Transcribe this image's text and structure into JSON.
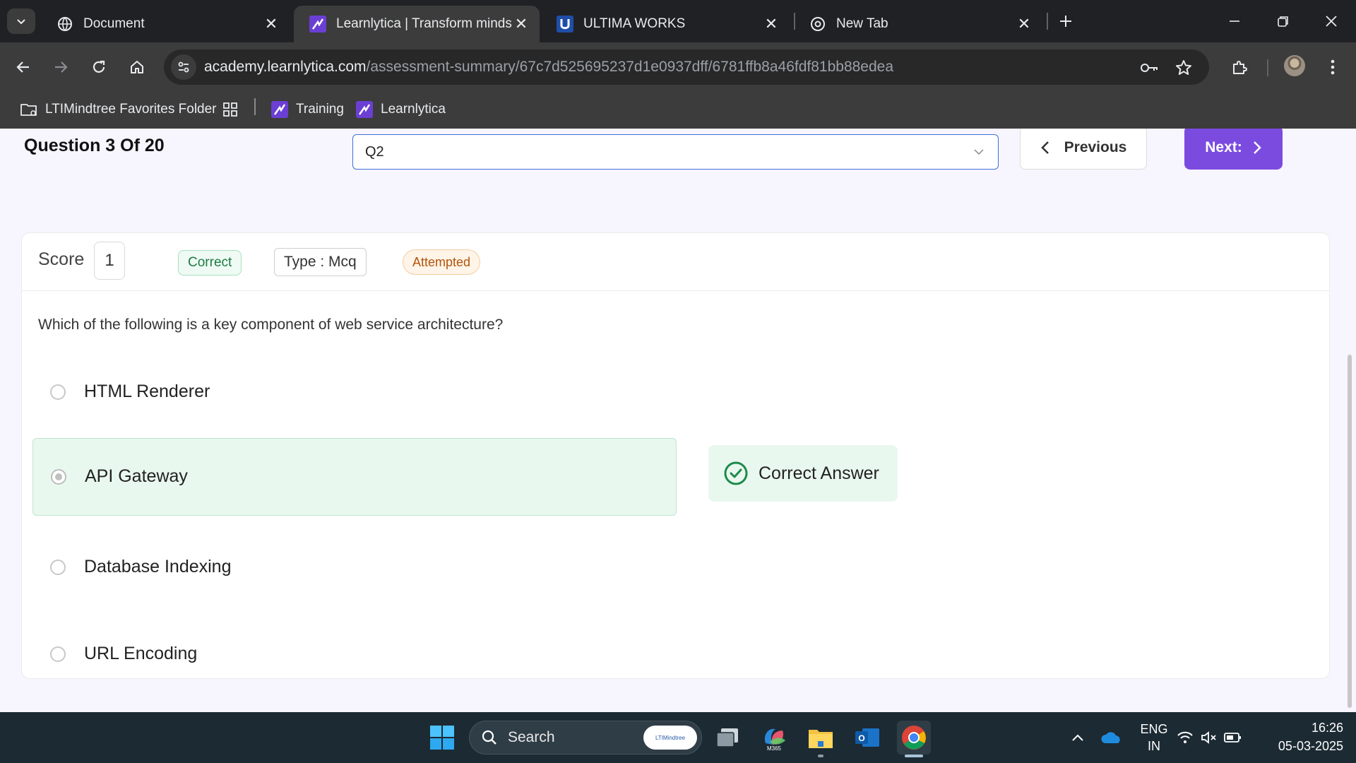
{
  "browser": {
    "tabs": [
      {
        "title": "Document",
        "favicon": "globe-icon",
        "active": false
      },
      {
        "title": "Learnlytica | Transform minds w",
        "favicon": "learnlytica-logo-icon",
        "active": true
      },
      {
        "title": "ULTIMA WORKS",
        "favicon": "ultima-logo-icon",
        "active": false
      },
      {
        "title": "New Tab",
        "favicon": "chrome-icon",
        "active": false
      }
    ],
    "url_host": "academy.learnlytica.com",
    "url_path": "/assessment-summary/67c7d525695237d1e0937dff/6781ffb8a46fdf81bb88edea",
    "bookmarks": [
      {
        "label": "LTIMindtree Favorites Folder",
        "icon": "folder-icon"
      },
      {
        "label": "",
        "icon": "apps-grid-icon"
      },
      {
        "label": "Training",
        "icon": "learnlytica-logo-icon"
      },
      {
        "label": "Learnlytica",
        "icon": "learnlytica-logo-icon"
      }
    ]
  },
  "assessment": {
    "counter": "Question 3 Of 20",
    "selected_question": "Q2",
    "prev_label": "Previous",
    "next_label": "Next:",
    "score_label": "Score",
    "score_value": "1",
    "status_badge": "Correct",
    "type_badge": "Type : Mcq",
    "attempt_badge": "Attempted",
    "question_text": "Which of the following is a key component of web service architecture?",
    "options": [
      {
        "label": "HTML Renderer",
        "selected": false
      },
      {
        "label": "API Gateway",
        "selected": true
      },
      {
        "label": "Database Indexing",
        "selected": false
      },
      {
        "label": "URL Encoding",
        "selected": false
      }
    ],
    "correct_answer_label": "Correct Answer"
  },
  "colors": {
    "accent": "#7b4be0",
    "correct_bg": "#e9f8ef",
    "correct_icon": "#1e8a4a",
    "attempted": "#b45309"
  },
  "taskbar": {
    "search_label": "Search",
    "search_pill": "LTIMindtree",
    "m365_label": "M365",
    "lang_primary": "ENG",
    "lang_secondary": "IN",
    "time": "16:26",
    "date": "05-03-2025"
  }
}
